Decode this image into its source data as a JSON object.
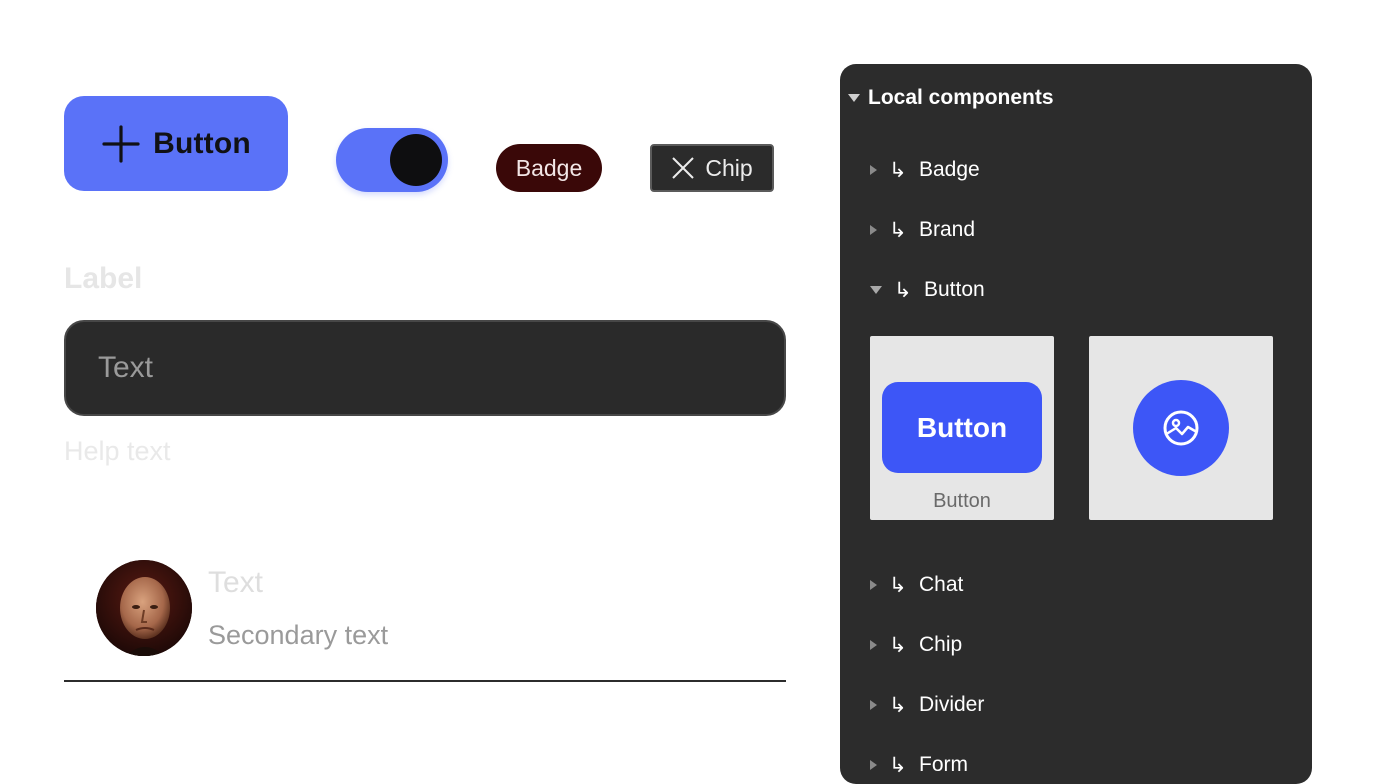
{
  "primary_button": {
    "label": "Button",
    "icon": "plus-icon",
    "color": "#5a72f8"
  },
  "toggle": {
    "state": "on",
    "color": "#5a72f8"
  },
  "badge": {
    "label": "Badge",
    "color": "#3a0808"
  },
  "chip": {
    "label": "Chip",
    "icon": "close-icon"
  },
  "form_field": {
    "label": "Label",
    "placeholder": "Text",
    "help_text": "Help text"
  },
  "list_item": {
    "primary_text": "Text",
    "secondary_text": "Secondary text",
    "avatar": "avatar-photo"
  },
  "panel": {
    "title": "Local components",
    "items": [
      {
        "label": "Badge",
        "expanded": false
      },
      {
        "label": "Brand",
        "expanded": false
      },
      {
        "label": "Button",
        "expanded": true
      },
      {
        "label": "Chat",
        "expanded": false
      },
      {
        "label": "Chip",
        "expanded": false
      },
      {
        "label": "Divider",
        "expanded": false
      },
      {
        "label": "Form",
        "expanded": false
      }
    ],
    "arrow_glyph": "↳",
    "button_previews": [
      {
        "label": "Button",
        "caption": "Button"
      },
      {
        "icon": "image-icon"
      }
    ],
    "accent_color": "#3d56f7"
  }
}
